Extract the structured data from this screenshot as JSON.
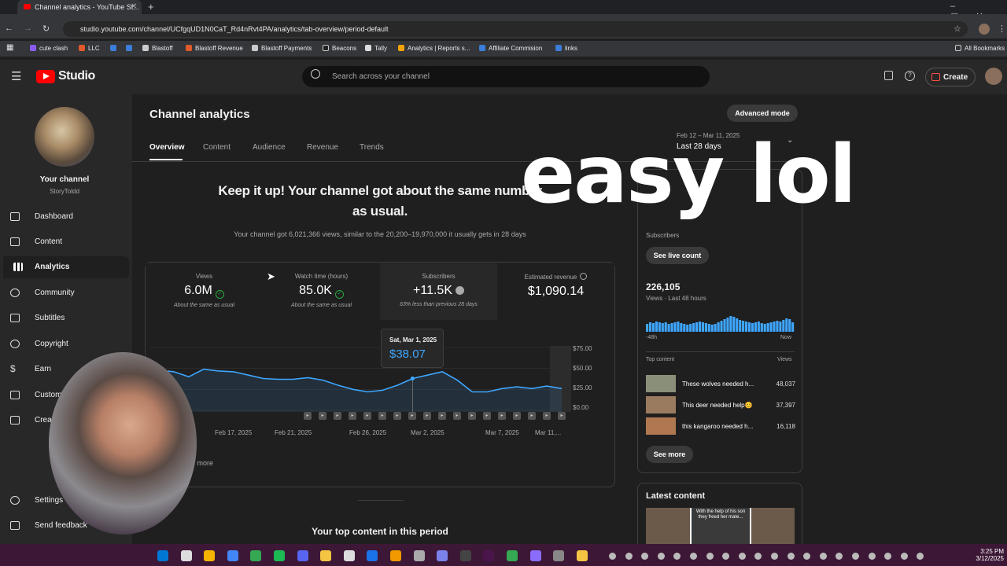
{
  "browser": {
    "tab_title": "Channel analytics - YouTube St...",
    "url": "studio.youtube.com/channel/UCfgqUD1N0CaT_Rd4nRvt4PA/analytics/tab-overview/period-default",
    "bookmarks": [
      "cute clash",
      "LLC",
      "Blastoff",
      "Blastoff Revenue",
      "Blastoff Payments",
      "Beacons",
      "Tally",
      "Analytics | Reports s...",
      "Affiliate Commision",
      "links"
    ],
    "all_bookmarks": "All Bookmarks"
  },
  "header": {
    "logo": "Studio",
    "search_placeholder": "Search across your channel",
    "create_label": "Create"
  },
  "sidebar": {
    "channel_title": "Your channel",
    "channel_handle": "StoryToldd",
    "items": [
      {
        "label": "Dashboard"
      },
      {
        "label": "Content"
      },
      {
        "label": "Analytics"
      },
      {
        "label": "Community"
      },
      {
        "label": "Subtitles"
      },
      {
        "label": "Copyright"
      },
      {
        "label": "Earn"
      },
      {
        "label": "Custom"
      },
      {
        "label": "Crea"
      }
    ],
    "settings": "Settings",
    "feedback": "Send feedback"
  },
  "main": {
    "title": "Channel analytics",
    "advanced_mode": "Advanced mode",
    "tabs": [
      "Overview",
      "Content",
      "Audience",
      "Revenue",
      "Trends"
    ],
    "date_range": "Feb 12 – Mar 11, 2025",
    "period": "Last 28 days",
    "headline_1": "Keep it up! Your channel got about the same number",
    "headline_2": "as usual.",
    "subline": "Your channel got 6,021,366 views, similar to the 20,200–19,970,000 it usually gets in 28 days",
    "metrics": [
      {
        "label": "Views",
        "value": "6.0M",
        "sub": "About the same as usual"
      },
      {
        "label": "Watch time (hours)",
        "value": "85.0K",
        "sub": "About the same as usual"
      },
      {
        "label": "Subscribers",
        "value": "+11.5K",
        "sub": "63% less than previous 28 days"
      },
      {
        "label": "Estimated revenue",
        "value": "$1,090.14",
        "sub": ""
      }
    ],
    "tooltip_date": "Sat, Mar 1, 2025",
    "tooltip_value": "$38.07",
    "see_more": "See more",
    "top_content_heading": "Your top content in this period"
  },
  "chart_data": {
    "type": "line",
    "x": [
      "Feb 12",
      "Feb 13",
      "Feb 14",
      "Feb 15",
      "Feb 16",
      "Feb 17",
      "Feb 18",
      "Feb 19",
      "Feb 20",
      "Feb 21",
      "Feb 22",
      "Feb 23",
      "Feb 24",
      "Feb 25",
      "Feb 26",
      "Feb 27",
      "Feb 28",
      "Mar 1",
      "Mar 2",
      "Mar 3",
      "Mar 4",
      "Mar 5",
      "Mar 6",
      "Mar 7",
      "Mar 8",
      "Mar 9",
      "Mar 10",
      "Mar 11"
    ],
    "values": [
      48,
      46,
      40,
      49,
      47,
      46,
      42,
      38,
      37,
      37,
      39,
      36,
      30,
      25,
      22,
      24,
      30,
      38,
      42,
      46,
      36,
      22,
      22,
      26,
      28,
      26,
      29,
      26
    ],
    "ylim": [
      0,
      75
    ],
    "yticks": [
      "$75.00",
      "$50.00",
      "$25.00",
      "$0.00"
    ],
    "xticks": [
      "Feb 17, 2025",
      "Feb 21, 2025",
      "Feb 26, 2025",
      "Mar 2, 2025",
      "Mar 7, 2025",
      "Mar 11,..."
    ],
    "line_color": "#3ea6ff"
  },
  "realtime": {
    "subscribers_label": "Subscribers",
    "see_live": "See live count",
    "views_value": "226,105",
    "views_label": "Views · Last 48 hours",
    "axis_left": "-48h",
    "axis_right": "Now",
    "top_content_label": "Top content",
    "views_col": "Views",
    "rows": [
      {
        "title": "These wolves needed h...",
        "views": "48,037"
      },
      {
        "title": "This deer needed help😊",
        "views": "37,397"
      },
      {
        "title": "this kangaroo needed h...",
        "views": "16,118"
      }
    ],
    "see_more": "See more",
    "latest_content": "Latest content",
    "latest_caption": "With the help of his son they freed her mate..."
  },
  "overlay_text": "easy lol",
  "taskbar": {
    "time": "3:25 PM",
    "date": "3/12/2025"
  }
}
